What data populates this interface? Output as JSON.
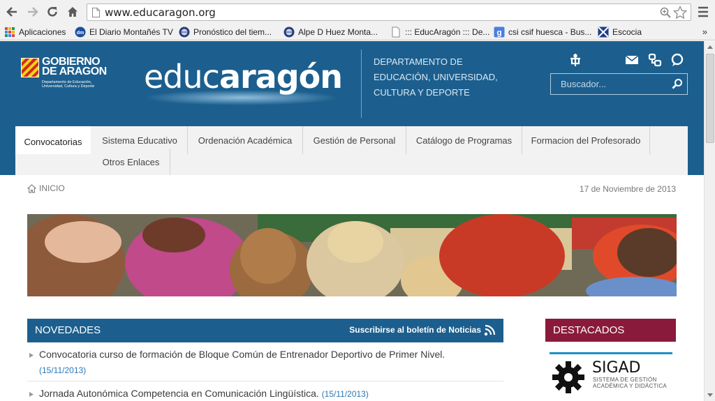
{
  "browser": {
    "url": "www.educaragon.org",
    "bookmarks": [
      {
        "label": "Aplicaciones",
        "icon": "apps-grid-icon"
      },
      {
        "label": "El Diario Montañés TV",
        "icon": "dm-favicon-icon"
      },
      {
        "label": "Pronóstico del tiem...",
        "icon": "globe-favicon-icon"
      },
      {
        "label": "Alpe D Huez Monta...",
        "icon": "globe-favicon-icon"
      },
      {
        "label": "::: EducAragón ::: De...",
        "icon": "page-icon"
      },
      {
        "label": "csi csif huesca - Bus...",
        "icon": "google-favicon-icon"
      },
      {
        "label": "Escocia",
        "icon": "escocia-favicon-icon"
      }
    ],
    "more": "»"
  },
  "header": {
    "gobierno": {
      "line1": "GOBIERNO",
      "line2": "DE ARAGON",
      "sub": "Departamento de Educación, Universidad, Cultura y Deporte"
    },
    "logo": {
      "part1": "educ",
      "part2": "aragón"
    },
    "department": "DEPARTAMENTO DE EDUCACIÓN, UNIVERSIDAD, CULTURA Y DEPORTE",
    "icons": [
      "accessibility-icon",
      "mail-icon",
      "sitemap-icon",
      "chat-icon"
    ],
    "search_placeholder": "Buscador..."
  },
  "nav": {
    "tabs": [
      {
        "label": "Convocatorias",
        "active": true
      },
      {
        "label": "Sistema Educativo"
      },
      {
        "label": "Ordenación Académica"
      },
      {
        "label": "Gestión de Personal"
      },
      {
        "label": "Catálogo de Programas"
      },
      {
        "label": "Formacion del Profesorado"
      },
      {
        "label": "Otros Enlaces"
      }
    ]
  },
  "breadcrumb": "INICIO",
  "date": "17 de Noviembre de 2013",
  "novedades": {
    "title": "NOVEDADES",
    "subscribe": "Suscribirse al boletín de Noticias",
    "items": [
      {
        "text": "Convocatoria curso de formación de Bloque Común de Entrenador Deportivo de Primer Nivel.",
        "date": "(15/11/2013)"
      },
      {
        "text": "Jornada Autonómica Competencia en Comunicación Lingüística.",
        "date": "(15/11/2013)"
      }
    ]
  },
  "destacados": {
    "title": "DESTACADOS",
    "sigad": {
      "name": "SIGAD",
      "line1": "SISTEMA DE GESTIÓN",
      "line2": "ACADÉMICA Y DIDÁCTICA"
    }
  },
  "colors": {
    "header_blue": "#1c5f8e",
    "destacados_red": "#8a1a3c",
    "date_blue": "#2a77b5"
  }
}
